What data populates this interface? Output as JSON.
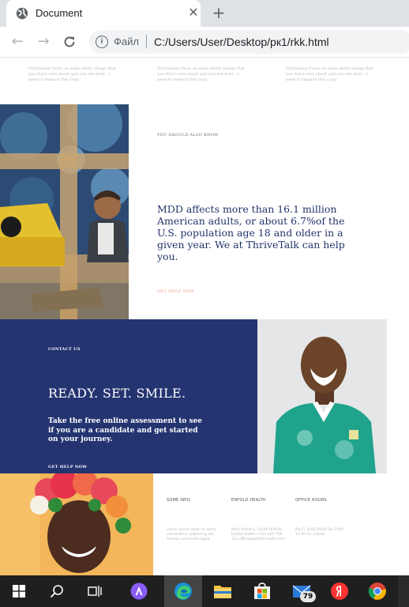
{
  "browser": {
    "tab_title": "Document",
    "protocol_label": "Файл",
    "address": "C:/Users/User/Desktop/рк1/rkk.html"
  },
  "page": {
    "ghost_columns": [
      "Nutritional Facts on some shitty things that you don't care about and you are dont , I need to replace this copy.",
      "Nutritional Facts on some shitty things that you don't care about and you are dont , I need to replace this copy.",
      "Nutritional Facts on some shitty things that you don't care about and you are dont , I need to replace this copy."
    ],
    "also_know": {
      "eyebrow": "YOU SHOULD ALSO KNOW",
      "text": "MDD affects more than 16.1 million American adults, or about 6.7%of the U.S. population age 18 and older in a given year. We at ThriveTalk can help you.",
      "link": "GET HELP NOW"
    },
    "cta": {
      "eyebrow": "CONTACT US",
      "headline": "READY. SET. SMILE.",
      "text": "Take the free online assessment to see if you are a candidate and get started on your journey.",
      "link": "GET HELP NOW"
    },
    "footer": {
      "columns": [
        {
          "heading": "SOME INFO",
          "body": "Lorem ipsum dolor sit amet, consectetur adipiscing elit. Aenean commodo ligula."
        },
        {
          "heading": "ENFOLD HEALTH",
          "body": "Main Street 1, Death Buffalo, United States +123 205 700 122 office@enfold-health.com"
        },
        {
          "heading": "OFFICE HOURS",
          "body": "Mo-Fr: 8:00-19:00 Sa: 8:00-14:00 Su: closed"
        }
      ]
    }
  },
  "taskbar": {
    "mail_badge": "79"
  },
  "colors": {
    "navy": "#243471",
    "accent_salmon": "#e8967a",
    "body_text": "#24346b"
  }
}
